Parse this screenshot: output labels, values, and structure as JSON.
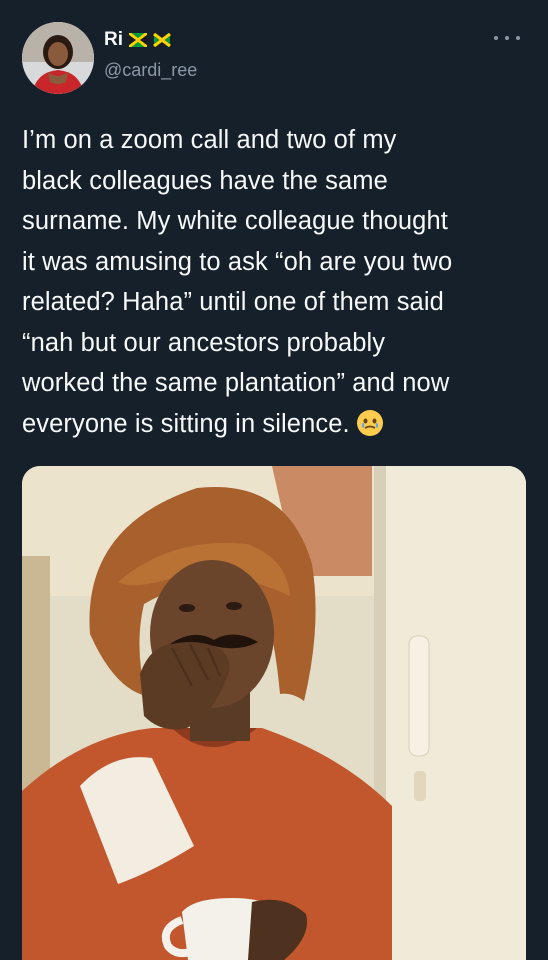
{
  "tweet": {
    "author": {
      "display_name": "Ri",
      "handle": "@cardi_ree",
      "flag_icons": [
        "jamaica-flag-icon",
        "jamaica-flag-icon"
      ]
    },
    "more_icon": "more-horizontal-icon",
    "text": "I’m on a zoom call and two of my\nblack colleagues have the same\nsurname. My white colleague thought\nit was amusing to ask “oh are you two\nrelated? Haha” until one of them said\n“nah but our ancestors probably\nworked the same plantation” and now\neveryone is sitting in silence.",
    "emoji": "face-holding-back-tears-emoji",
    "media": {
      "type": "photo"
    }
  }
}
